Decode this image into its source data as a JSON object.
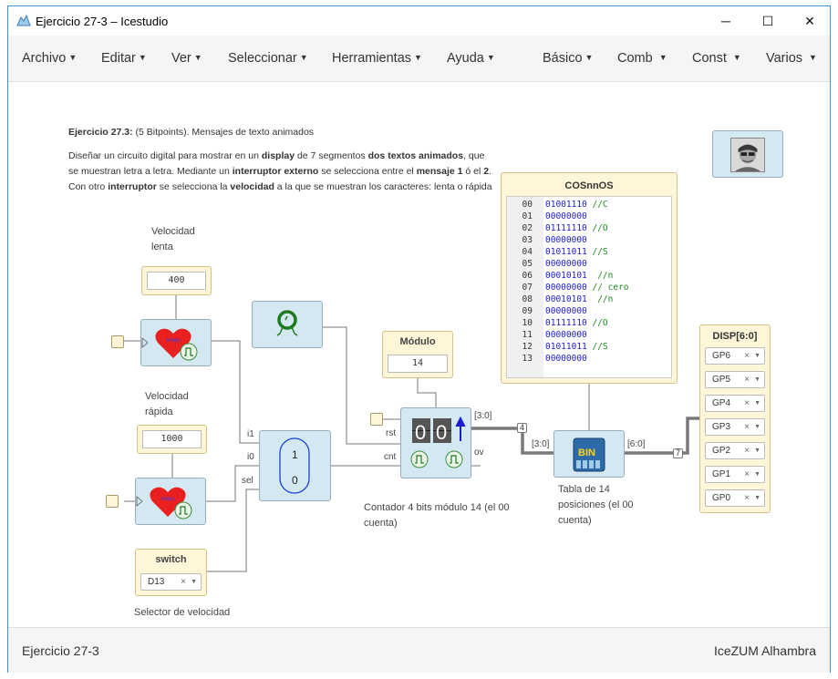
{
  "window": {
    "title": "Ejercicio 27-3 – Icestudio",
    "buttons": {
      "minimize": "─",
      "maximize": "☐",
      "close": "✕"
    }
  },
  "menu": {
    "left": [
      "Archivo",
      "Editar",
      "Ver",
      "Seleccionar",
      "Herramientas",
      "Ayuda"
    ],
    "right": [
      "Básico",
      "Comb",
      "Const",
      "Varios"
    ]
  },
  "info": {
    "heading_bold": "Ejercicio 27.3:",
    "heading_rest": " (5 Bitpoints). Mensajes de texto animados",
    "p_1": "Diseñar un circuito digital para mostrar en un ",
    "p_b1": "display",
    "p_2": " de 7 segmentos ",
    "p_b2": "dos textos animados",
    "p_3": ", que se muestran letra a letra. Mediante un ",
    "p_b3": "interruptor externo",
    "p_4": " se selecciona entre el ",
    "p_b4": "mensaje 1",
    "p_5": " ó el ",
    "p_b5": "2",
    "p_6": ". Con otro ",
    "p_b6": "interruptor",
    "p_7": " se selecciona la ",
    "p_b7": "velocidad",
    "p_8": " a la que se muestran los caracteres: lenta o rápida"
  },
  "circuit": {
    "vel_lenta_label_1": "Velocidad",
    "vel_lenta_label_2": "lenta",
    "vel_lenta_value": "400",
    "vel_rapida_label_1": "Velocidad",
    "vel_rapida_label_2": "rápida",
    "vel_rapida_value": "1000",
    "heart_text": "mass",
    "mux_in_1": "1",
    "mux_in_0": "0",
    "mux_port_i1": "i1",
    "mux_port_i0": "i0",
    "mux_port_sel": "sel",
    "switch_label": "switch",
    "switch_pin": "D13",
    "switch_caption": "Selector de velocidad",
    "modulo_label": "Módulo",
    "modulo_value": "14",
    "counter_port_rst": "rst",
    "counter_port_cnt": "cnt",
    "counter_port_ov": "ov",
    "counter_digits": [
      "0",
      "0"
    ],
    "counter_caption": "Contador 4 bits módulo 14 (el 00 cuenta)",
    "bus_label_out": "[3:0]",
    "bus_width_4": "4",
    "rom_in_label": "[3:0]",
    "rom_out_label": "[6:0]",
    "bus_width_7": "7",
    "rom_icon_text": "BIN",
    "rom_caption": "Tabla de 14 posiciones (el 00 cuenta)",
    "rom_title": "COSnnOS",
    "disp_title": "DISP[6:0]",
    "disp_pins": [
      "GP6",
      "GP5",
      "GP4",
      "GP3",
      "GP2",
      "GP1",
      "GP0"
    ],
    "pin_clear": "×"
  },
  "rom_lines": [
    {
      "n": "00",
      "code": "01001110",
      "comment": " //C"
    },
    {
      "n": "01",
      "code": "00000000",
      "comment": ""
    },
    {
      "n": "02",
      "code": "01111110",
      "comment": " //O"
    },
    {
      "n": "03",
      "code": "00000000",
      "comment": ""
    },
    {
      "n": "04",
      "code": "01011011",
      "comment": " //S"
    },
    {
      "n": "05",
      "code": "00000000",
      "comment": ""
    },
    {
      "n": "06",
      "code": "00010101",
      "comment": "  //n"
    },
    {
      "n": "07",
      "code": "00000000",
      "comment": " // cero"
    },
    {
      "n": "08",
      "code": "00010101",
      "comment": "  //n"
    },
    {
      "n": "09",
      "code": "00000000",
      "comment": ""
    },
    {
      "n": "10",
      "code": "01111110",
      "comment": " //O"
    },
    {
      "n": "11",
      "code": "00000000",
      "comment": ""
    },
    {
      "n": "12",
      "code": "01011011",
      "comment": " //S"
    },
    {
      "n": "13",
      "code": "00000000",
      "comment": ""
    }
  ],
  "status": {
    "left": "Ejercicio 27-3",
    "right": "IceZUM Alhambra"
  },
  "colors": {
    "window_border": "#3d8fd6",
    "block_bg": "#d4e8f2",
    "const_bg": "#fff6d9",
    "mux_oval": "#1c3fd1",
    "rom_code": "#1c1cd1",
    "rom_comment": "#1f8a1f"
  }
}
